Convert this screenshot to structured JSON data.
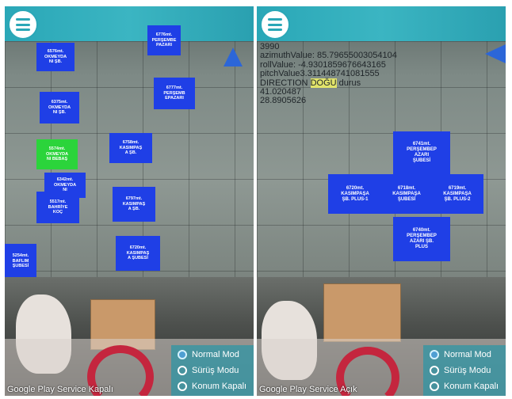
{
  "left_screen": {
    "tags": [
      {
        "text": "6776mt.\nPERŞEMBE\nPAZARI",
        "color": "blue"
      },
      {
        "text": "6576mt.\nOKMEYDA\nNI ŞB.",
        "color": "blue"
      },
      {
        "text": "6375mt.\nOKMEYDA\nNI ŞB.",
        "color": "blue"
      },
      {
        "text": "6777mt.\nPERŞEMB\nEPAZARI",
        "color": "blue"
      },
      {
        "text": "5574mt.\nOKMEYDA\nNI BEBAŞ",
        "color": "green"
      },
      {
        "text": "6758mt.\nKASIMPAŞ\nA ŞB.",
        "color": "blue"
      },
      {
        "text": "6342mt.\nOKMEYDA\nNI",
        "color": "blue"
      },
      {
        "text": "5517mt.\nBAHRİYE\nKOÇ",
        "color": "blue"
      },
      {
        "text": "6797mt.\nKASIMPAŞ\nA ŞB.",
        "color": "blue"
      },
      {
        "text": "5254mt.\nBAFLIM\nŞUBESİ",
        "color": "blue"
      },
      {
        "text": "6720mt.\nKASIMPAŞ\nA ŞUBESİ",
        "color": "blue"
      }
    ],
    "options": [
      "Normal Mod",
      "Sürüş Modu",
      "Konum Kapalı"
    ],
    "selected_option": "Normal Mod",
    "status": "Google Play Service Kapalı"
  },
  "right_screen": {
    "hud": [
      "3990",
      "azimuthValue: 85.79655003054104",
      "rollValue: -4.9301859676643165",
      "pitchValue3.311448741081555",
      "DIRECTION DOĞU durus",
      "41.020487",
      "28.8905626"
    ],
    "direction_highlight": "DOĞU",
    "tags": [
      {
        "text": "6741mt.\nPERŞEMBEP\nAZARI\nŞUBESİ"
      },
      {
        "text": "6720mt.\nKASIMPAŞA\nŞB. PLUS-1"
      },
      {
        "text": "6718mt.\nKASIMPAŞA\nŞUBESİ"
      },
      {
        "text": "6719mt.\nKASIMPAŞA\nŞB. PLUS-2"
      },
      {
        "text": "6740mt.\nPERŞEMBEP\nAZARI ŞB.\nPLUS"
      }
    ],
    "options": [
      "Normal Mod",
      "Sürüş Modu",
      "Konum Kapalı"
    ],
    "selected_option": "Normal Mod",
    "status": "Google Play Service Açık"
  },
  "colors": {
    "accent": "#2aa7b7",
    "tag_blue": "#1f3fe6",
    "tag_green": "#2bd43b"
  },
  "icons": {
    "menu": "hamburger-menu-icon",
    "compass": "navigation-arrow-icon"
  }
}
